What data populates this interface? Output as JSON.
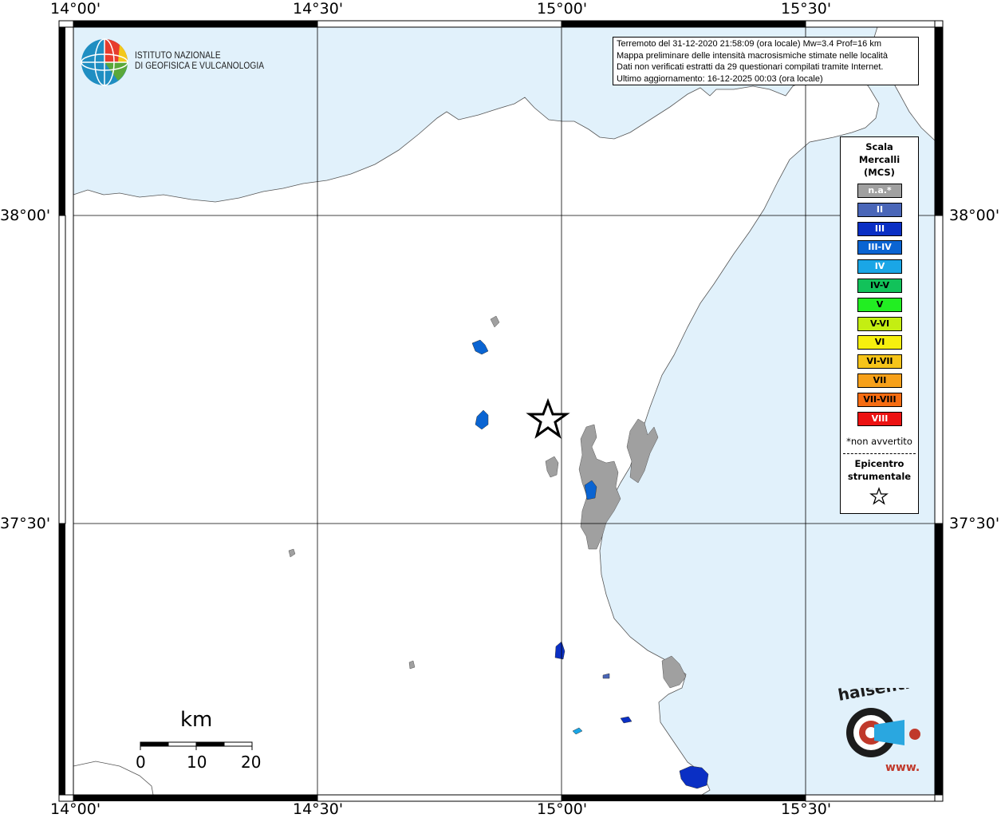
{
  "header": {
    "logo": {
      "line1": "ISTITUTO NAZIONALE",
      "line2": "DI GEOFISICA E VULCANOLOGIA"
    }
  },
  "info_box": {
    "line1": "Terremoto del 31-12-2020 21:58:09 (ora locale) Mw=3.4 Prof=16 km",
    "line2": "Mappa preliminare delle intensità macrosismiche stimate nelle località",
    "line3": "Dati non verificati estratti da 29 questionari compilati tramite Internet.",
    "line4": "Ultimo aggiornamento: 16-12-2025 00:03 (ora locale)"
  },
  "axes": {
    "longitude_labels": [
      "14°00'",
      "14°30'",
      "15°00'",
      "15°30'"
    ],
    "latitude_labels": [
      "38°00'",
      "37°30'"
    ]
  },
  "legend": {
    "title_line1": "Scala",
    "title_line2": "Mercalli",
    "title_line3": "(MCS)",
    "items": [
      {
        "label": "n.a.*",
        "color": "#a0a0a0"
      },
      {
        "label": "II",
        "color": "#4a66b8"
      },
      {
        "label": "III",
        "color": "#0a2fc4"
      },
      {
        "label": "III-IV",
        "color": "#0a64d2"
      },
      {
        "label": "IV",
        "color": "#1aa6e6"
      },
      {
        "label": "IV-V",
        "color": "#12c25a"
      },
      {
        "label": "V",
        "color": "#22ee22"
      },
      {
        "label": "V-VI",
        "color": "#c4ee12"
      },
      {
        "label": "VI",
        "color": "#f6f00e"
      },
      {
        "label": "VI-VII",
        "color": "#f6c41a"
      },
      {
        "label": "VII",
        "color": "#f6a01a"
      },
      {
        "label": "VII-VIII",
        "color": "#f66c12"
      },
      {
        "label": "VIII",
        "color": "#ec1212"
      }
    ],
    "note": "*non avvertito",
    "epicenter_line1": "Epicentro",
    "epicenter_line2": "strumentale"
  },
  "scalebar": {
    "unit": "km",
    "ticks": [
      "0",
      "10",
      "20"
    ]
  },
  "colors": {
    "sea": "#e1f1fb",
    "land": "#ffffff",
    "not_felt": "#a0a0a0",
    "intensity_II": "#4a66b8",
    "intensity_III": "#0a2fc4",
    "intensity_III_IV": "#0a64d2",
    "intensity_IV": "#1aa6e6"
  },
  "brand": {
    "site": "haisentitoilterremoto.it",
    "url": "www."
  }
}
